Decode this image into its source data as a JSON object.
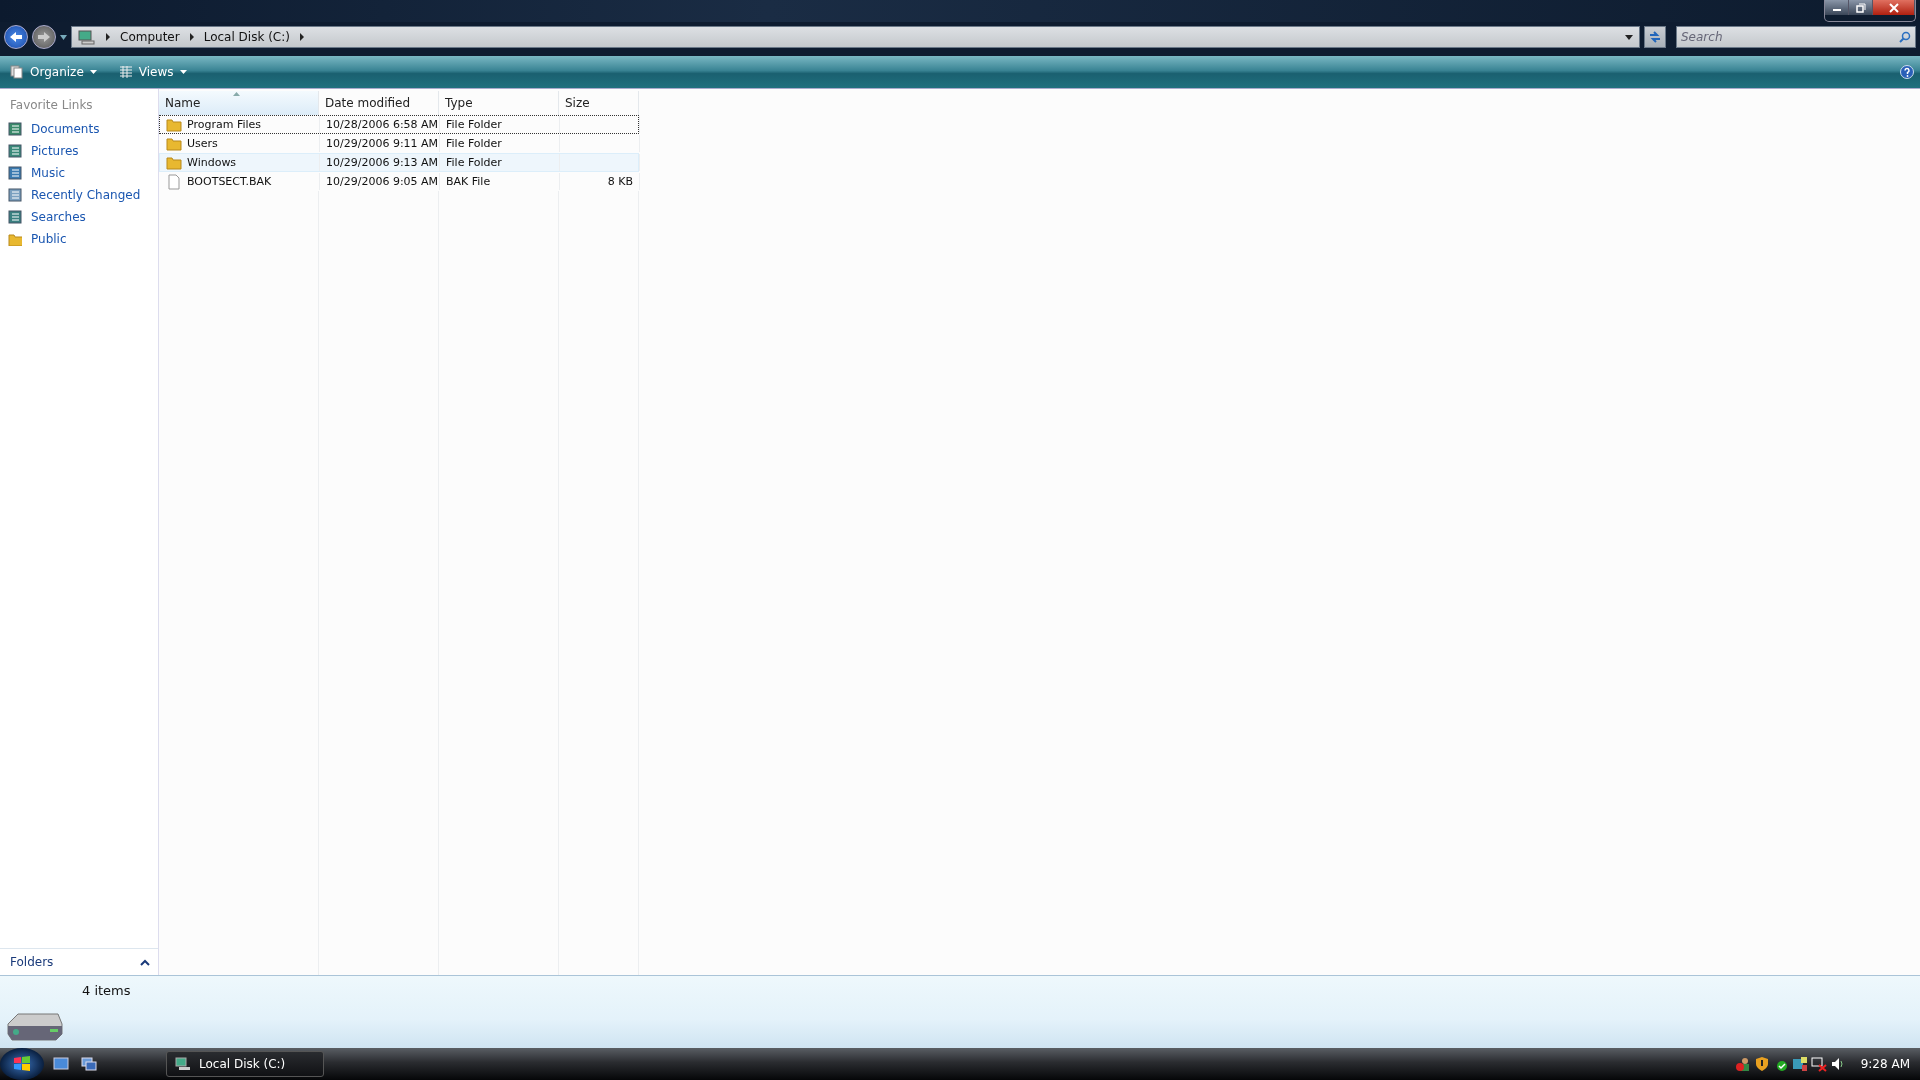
{
  "address_bar": {
    "crumbs": [
      "Computer",
      "Local Disk (C:)"
    ]
  },
  "search": {
    "placeholder": "Search"
  },
  "toolbar": {
    "buttons": [
      "Organize",
      "Views"
    ]
  },
  "sidebar": {
    "heading": "Favorite Links",
    "items": [
      {
        "label": "Documents"
      },
      {
        "label": "Pictures"
      },
      {
        "label": "Music"
      },
      {
        "label": "Recently Changed"
      },
      {
        "label": "Searches"
      },
      {
        "label": "Public"
      }
    ],
    "folders_label": "Folders"
  },
  "table": {
    "columns": [
      {
        "label": "Name",
        "sorted": true
      },
      {
        "label": "Date modified",
        "sorted": false
      },
      {
        "label": "Type",
        "sorted": false
      },
      {
        "label": "Size",
        "sorted": false
      }
    ],
    "rows": [
      {
        "kind": "folder",
        "name": "Program Files",
        "date": "10/28/2006 6:58 AM",
        "type": "File Folder",
        "focused": true,
        "hovered": false
      },
      {
        "kind": "folder",
        "name": "Users",
        "date": "10/29/2006 9:11 AM",
        "type": "File Folder",
        "focused": false,
        "hovered": false
      },
      {
        "kind": "folder",
        "name": "Windows",
        "date": "10/29/2006 9:13 AM",
        "type": "File Folder",
        "focused": false,
        "hovered": true
      },
      {
        "kind": "file",
        "name": "BOOTSECT.BAK",
        "date": "10/29/2006 9:05 AM",
        "type": "BAK File",
        "size": "8 KB",
        "focused": false,
        "hovered": false
      }
    ]
  },
  "status_bar": {
    "count": "4 items"
  },
  "taskbar": {
    "window_button": "Local Disk (C:)",
    "clock": "9:28 AM"
  }
}
